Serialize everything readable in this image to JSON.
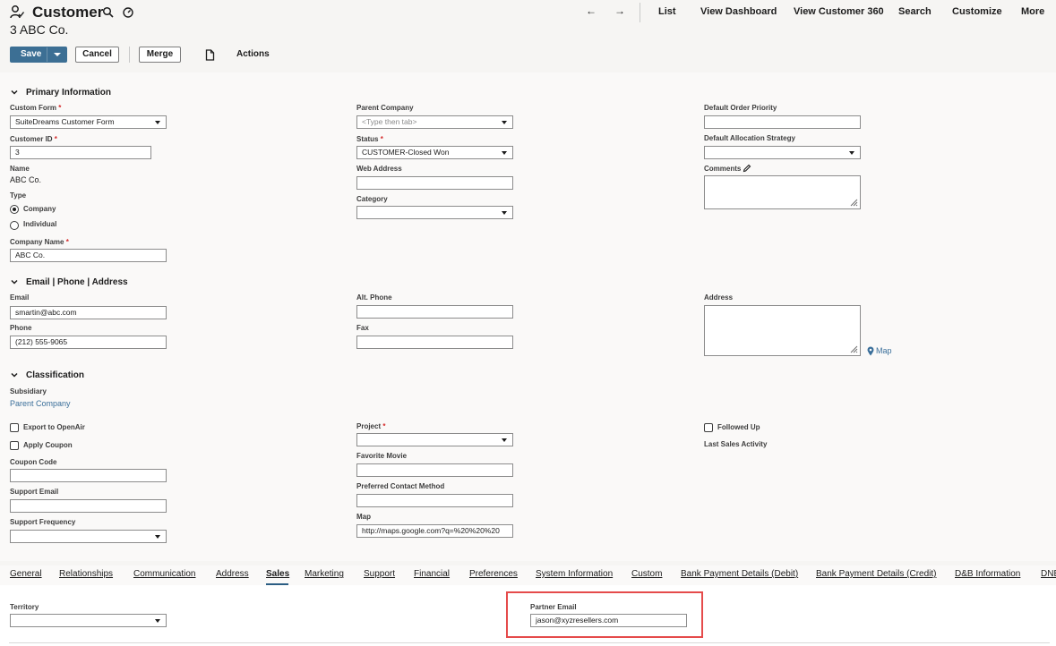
{
  "header": {
    "record_type": "Customer",
    "record_name": "3 ABC Co."
  },
  "nav": {
    "back": "←",
    "forward": "→",
    "list": "List",
    "view_dashboard": "View Dashboard",
    "view_customer_360": "View Customer 360",
    "search": "Search",
    "customize": "Customize",
    "more": "More"
  },
  "toolbar": {
    "save": "Save",
    "cancel": "Cancel",
    "merge": "Merge",
    "actions": "Actions"
  },
  "primary": {
    "heading": "Primary Information",
    "custom_form_label": "Custom Form",
    "custom_form_value": "SuiteDreams Customer Form",
    "customer_id_label": "Customer ID",
    "customer_id_value": "3",
    "name_label": "Name",
    "name_value": "ABC Co.",
    "type_label": "Type",
    "type_options": [
      "Company",
      "Individual"
    ],
    "type_selected": "Company",
    "company_name_label": "Company Name",
    "company_name_value": "ABC Co.",
    "parent_company_label": "Parent Company",
    "parent_company_placeholder": "<Type then tab>",
    "status_label": "Status",
    "status_value": "CUSTOMER-Closed Won",
    "web_address_label": "Web Address",
    "web_address_value": "",
    "category_label": "Category",
    "category_value": "",
    "default_order_priority_label": "Default Order Priority",
    "default_order_priority_value": "",
    "default_allocation_strategy_label": "Default Allocation Strategy",
    "default_allocation_strategy_value": "",
    "comments_label": "Comments",
    "comments_value": ""
  },
  "contact": {
    "heading": "Email | Phone | Address",
    "email_label": "Email",
    "email_value": "smartin@abc.com",
    "phone_label": "Phone",
    "phone_value": "(212) 555-9065",
    "alt_phone_label": "Alt. Phone",
    "alt_phone_value": "",
    "fax_label": "Fax",
    "fax_value": "",
    "address_label": "Address",
    "address_value": "",
    "map_link": "Map"
  },
  "classification": {
    "heading": "Classification",
    "subsidiary_label": "Subsidiary",
    "subsidiary_value": "Parent Company",
    "export_openair_label": "Export to OpenAir",
    "export_openair_checked": false,
    "apply_coupon_label": "Apply Coupon",
    "apply_coupon_checked": false,
    "coupon_code_label": "Coupon Code",
    "coupon_code_value": "",
    "support_email_label": "Support Email",
    "support_email_value": "",
    "support_frequency_label": "Support Frequency",
    "support_frequency_value": "",
    "project_label": "Project",
    "project_value": "",
    "favorite_movie_label": "Favorite Movie",
    "favorite_movie_value": "",
    "preferred_contact_label": "Preferred Contact Method",
    "preferred_contact_value": "",
    "map_label": "Map",
    "map_value": "http://maps.google.com?q=%20%20%20",
    "followed_up_label": "Followed Up",
    "followed_up_checked": false,
    "last_sales_activity_label": "Last Sales Activity"
  },
  "tabs": [
    "General",
    "Relationships",
    "Communication",
    "Address",
    "Sales",
    "Marketing",
    "Support",
    "Financial",
    "Preferences",
    "System Information",
    "Custom",
    "Bank Payment Details (Debit)",
    "Bank Payment Details (Credit)",
    "D&B Information",
    "DNB"
  ],
  "active_tab": "Sales",
  "sales": {
    "territory_label": "Territory",
    "territory_value": "",
    "partner_email_label": "Partner Email",
    "partner_email_value": "jason@xyzresellers.com"
  },
  "colors": {
    "primary_button": "#3c6f94",
    "link": "#3a6f9a",
    "required": "#d42b2b",
    "highlight_box": "#e54b4b"
  }
}
